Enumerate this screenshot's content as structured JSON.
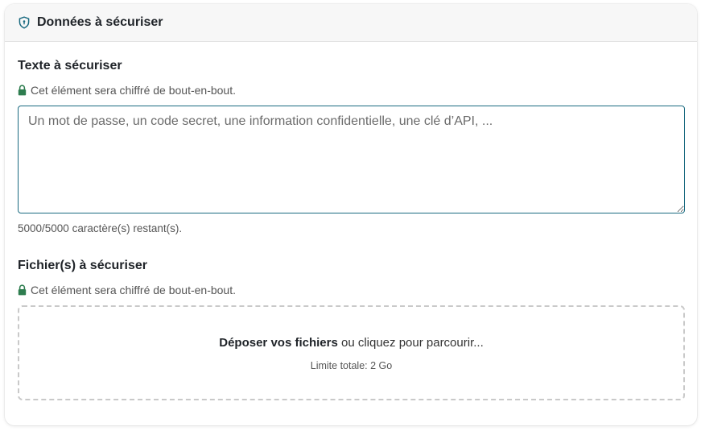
{
  "header": {
    "title": "Données à sécuriser",
    "icon": "shield-icon"
  },
  "text_section": {
    "title": "Texte à sécuriser",
    "note": "Cet élément sera chiffré de bout-en-bout.",
    "textarea_placeholder": "Un mot de passe, un code secret, une information confidentielle, une clé d’API, ...",
    "textarea_value": "",
    "counter": "5000/5000 caractère(s) restant(s)."
  },
  "file_section": {
    "title": "Fichier(s) à sécuriser",
    "note": "Cet élément sera chiffré de bout-en-bout.",
    "drop_bold": "Déposer vos fichiers",
    "drop_rest": " ou cliquez pour parcourir...",
    "limit": "Limite totale: 2 Go"
  },
  "colors": {
    "accent": "#1a6a80",
    "lock": "#2e7d4f"
  }
}
